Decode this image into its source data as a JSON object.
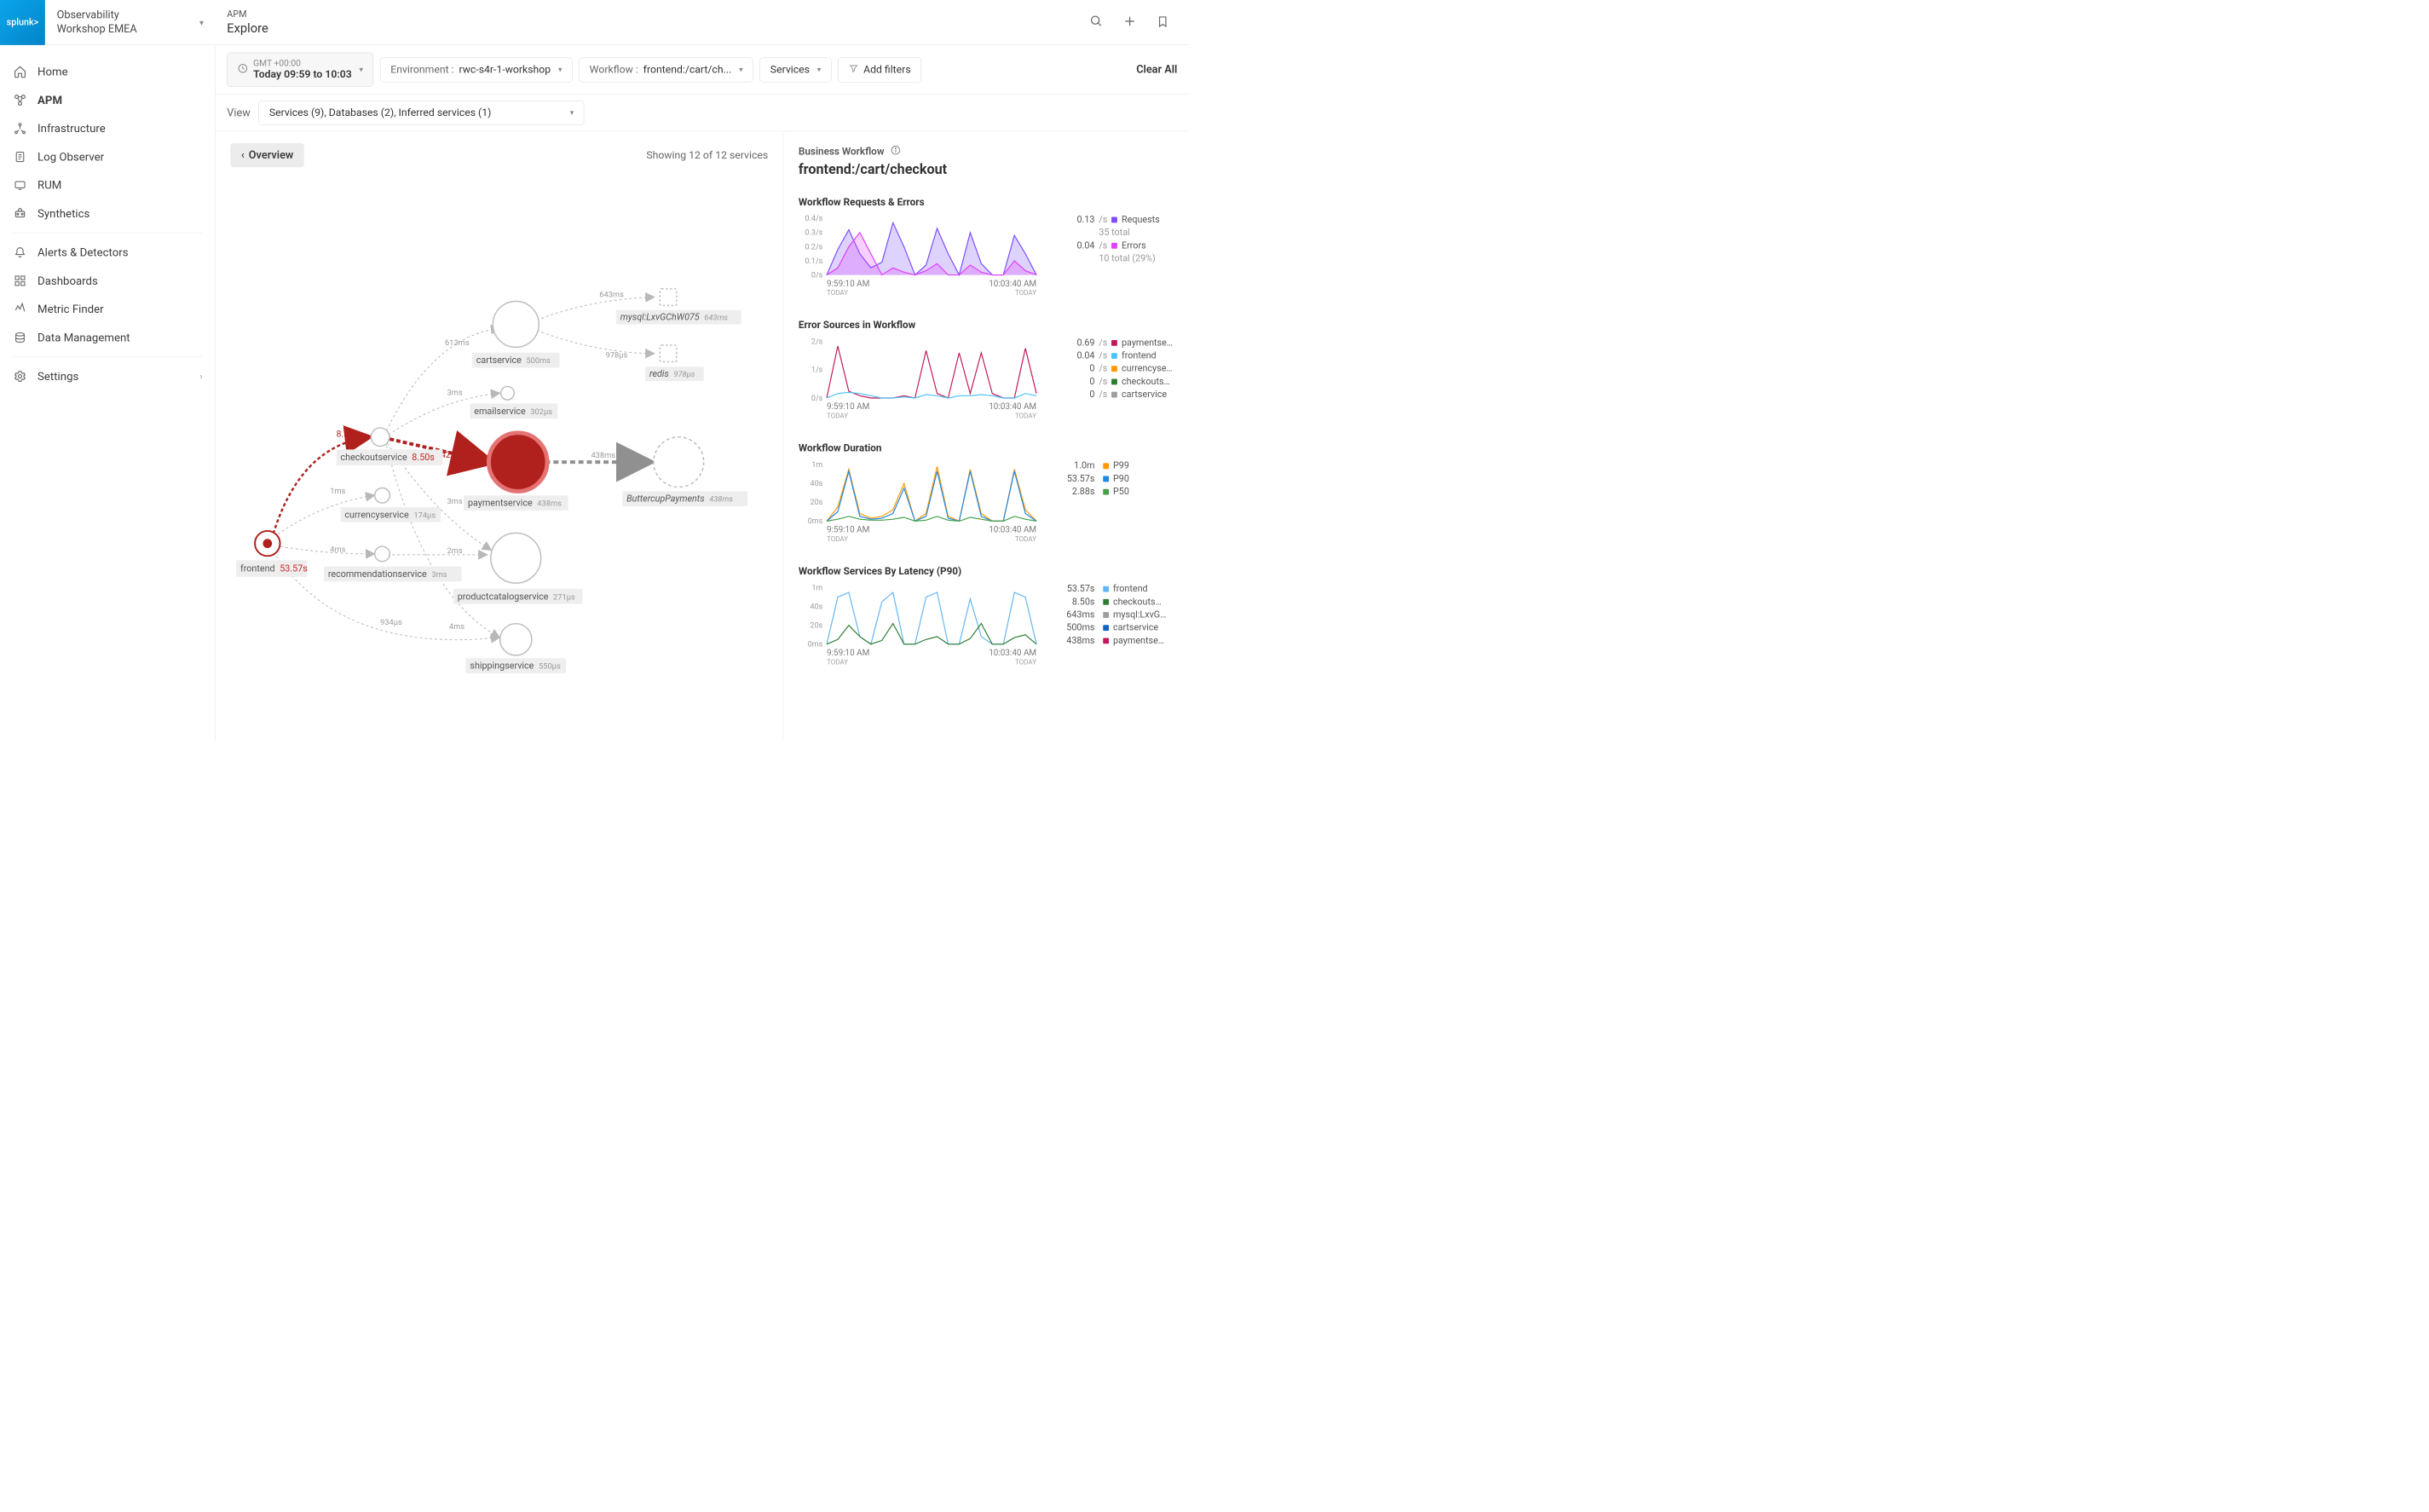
{
  "header": {
    "logo": "splunk>",
    "workspace": "Observability\nWorkshop EMEA",
    "breadcrumb_top": "APM",
    "breadcrumb_bottom": "Explore"
  },
  "sidebar": {
    "items": [
      {
        "label": "Home",
        "icon": "home"
      },
      {
        "label": "APM",
        "icon": "apm",
        "active": true
      },
      {
        "label": "Infrastructure",
        "icon": "infra"
      },
      {
        "label": "Log Observer",
        "icon": "log"
      },
      {
        "label": "RUM",
        "icon": "rum"
      },
      {
        "label": "Synthetics",
        "icon": "synth"
      }
    ],
    "items2": [
      {
        "label": "Alerts & Detectors",
        "icon": "alert"
      },
      {
        "label": "Dashboards",
        "icon": "dash"
      },
      {
        "label": "Metric Finder",
        "icon": "metric"
      },
      {
        "label": "Data Management",
        "icon": "data"
      }
    ],
    "settings": "Settings"
  },
  "filters": {
    "time_tz": "GMT +00:00",
    "time_range": "Today 09:59 to 10:03",
    "env_label": "Environment :",
    "env_value": "rwc-s4r-1-workshop",
    "wf_label": "Workflow :",
    "wf_value": "frontend:/cart/ch...",
    "services": "Services",
    "add_filters": "Add filters",
    "clear": "Clear All"
  },
  "viewbar": {
    "view": "View",
    "selected": "Services (9), Databases (2), Inferred services (1)"
  },
  "map": {
    "overview": "Overview",
    "showing": "Showing 12 of 12 services",
    "nodes": {
      "frontend": {
        "name": "frontend",
        "lat": "53.57s",
        "err": true
      },
      "checkout": {
        "name": "checkoutservice",
        "lat": "8.50s",
        "err": true
      },
      "currency": {
        "name": "currencyservice",
        "lat": "174µs"
      },
      "recommendation": {
        "name": "recommendationservice",
        "lat": "3ms"
      },
      "payment": {
        "name": "paymentservice",
        "lat": "438ms",
        "err": true
      },
      "email": {
        "name": "emailservice",
        "lat": "302µs"
      },
      "productcatalog": {
        "name": "productcatalogservice",
        "lat": "271µs"
      },
      "shipping": {
        "name": "shippingservice",
        "lat": "550µs"
      },
      "cart": {
        "name": "cartservice",
        "lat": "500ms"
      },
      "buttercup": {
        "name": "ButtercupPayments",
        "lat": "438ms"
      },
      "mysql": {
        "name": "mysql:LxvGChW075",
        "lat": "643ms"
      },
      "redis": {
        "name": "redis",
        "lat": "978µs"
      }
    },
    "edges": {
      "f_checkout": "8.50s",
      "f_currency": "1ms",
      "f_recommendation": "4ms",
      "f_shipping": "934µs",
      "co_cart": "613ms",
      "co_email": "3ms",
      "co_payment": "425ms",
      "co_catalog": "3ms",
      "co_ship": "4ms",
      "rec_catalog": "2ms",
      "pay_butter": "438ms",
      "cart_mysql": "643ms",
      "cart_redis": "978µs"
    }
  },
  "right": {
    "bw_label": "Business Workflow",
    "bw_title": "frontend:/cart/checkout"
  },
  "charts": [
    {
      "title": "Workflow Requests & Errors",
      "yticks": [
        "0.4/s",
        "0.3/s",
        "0.2/s",
        "0.1/s",
        "0/s"
      ],
      "legend": [
        {
          "v": "0.13",
          "u": "/s",
          "c": "#7c4dff",
          "n": "Requests"
        },
        {
          "sub": "35  total"
        },
        {
          "v": "0.04",
          "u": "/s",
          "c": "#e040fb",
          "n": "Errors"
        },
        {
          "sub": "10  total (29%)"
        }
      ]
    },
    {
      "title": "Error Sources in Workflow",
      "yticks": [
        "2/s",
        "1/s",
        "0/s"
      ],
      "legend": [
        {
          "v": "0.69",
          "u": "/s",
          "c": "#c2185b",
          "n": "paymentse…"
        },
        {
          "v": "0.04",
          "u": "/s",
          "c": "#4fc3f7",
          "n": "frontend"
        },
        {
          "v": "0",
          "u": "/s",
          "c": "#ff9800",
          "n": "currencyse…"
        },
        {
          "v": "0",
          "u": "/s",
          "c": "#2e7d32",
          "n": "checkouts…"
        },
        {
          "v": "0",
          "u": "/s",
          "c": "#9e9e9e",
          "n": "cartservice"
        }
      ]
    },
    {
      "title": "Workflow Duration",
      "yticks": [
        "1m",
        "40s",
        "20s",
        "0ms"
      ],
      "legend": [
        {
          "v": "1.0m",
          "u": "",
          "c": "#ff9800",
          "n": "P99"
        },
        {
          "v": "53.57s",
          "u": "",
          "c": "#1e88e5",
          "n": "P90"
        },
        {
          "v": "2.88s",
          "u": "",
          "c": "#43a047",
          "n": "P50"
        }
      ]
    },
    {
      "title": "Workflow Services By Latency (P90)",
      "yticks": [
        "1m",
        "40s",
        "20s",
        "0ms"
      ],
      "legend": [
        {
          "v": "53.57s",
          "u": "",
          "c": "#64b5f6",
          "n": "frontend"
        },
        {
          "v": "8.50s",
          "u": "",
          "c": "#2e7d32",
          "n": "checkouts…"
        },
        {
          "v": "643ms",
          "u": "",
          "c": "#9e9e9e",
          "n": "mysql:LxvG…"
        },
        {
          "v": "500ms",
          "u": "",
          "c": "#1565c0",
          "n": "cartservice"
        },
        {
          "v": "438ms",
          "u": "",
          "c": "#c2185b",
          "n": "paymentse…"
        }
      ]
    }
  ],
  "time_axis": {
    "start": "9:59:10 AM",
    "end": "10:03:40 AM",
    "today": "TODAY"
  },
  "chart_data": [
    {
      "type": "area",
      "title": "Workflow Requests & Errors",
      "x": [
        0,
        1,
        2,
        3,
        4,
        5,
        6,
        7,
        8,
        9,
        10,
        11,
        12,
        13,
        14,
        15,
        16,
        17,
        18,
        19
      ],
      "series": [
        {
          "name": "Requests",
          "values": [
            0,
            0.18,
            0.32,
            0.15,
            0.05,
            0.09,
            0.37,
            0.2,
            0,
            0.07,
            0.33,
            0.15,
            0,
            0.3,
            0.08,
            0,
            0,
            0.28,
            0.15,
            0
          ]
        },
        {
          "name": "Errors",
          "values": [
            0,
            0.05,
            0.2,
            0.3,
            0.15,
            0,
            0.05,
            0.02,
            0,
            0.03,
            0.08,
            0,
            0,
            0.07,
            0.02,
            0,
            0,
            0.1,
            0.03,
            0
          ]
        }
      ],
      "ylim": [
        0,
        0.4
      ]
    },
    {
      "type": "line",
      "title": "Error Sources in Workflow",
      "x": [
        0,
        1,
        2,
        3,
        4,
        5,
        6,
        7,
        8,
        9,
        10,
        11,
        12,
        13,
        14,
        15,
        16,
        17,
        18,
        19
      ],
      "series": [
        {
          "name": "paymentservice",
          "values": [
            0,
            2.3,
            0.3,
            0.1,
            0,
            0,
            0,
            0.1,
            0,
            2.1,
            0.2,
            0,
            2.0,
            0.2,
            2.0,
            0.2,
            0,
            0,
            2.2,
            0.2
          ]
        },
        {
          "name": "frontend",
          "values": [
            0,
            0.2,
            0.25,
            0.2,
            0.1,
            0,
            0,
            0.05,
            0,
            0.15,
            0.1,
            0,
            0.1,
            0.1,
            0.15,
            0.1,
            0,
            0,
            0.2,
            0.1
          ]
        }
      ],
      "ylim": [
        0,
        2.5
      ]
    },
    {
      "type": "line",
      "title": "Workflow Duration",
      "x": [
        0,
        1,
        2,
        3,
        4,
        5,
        6,
        7,
        8,
        9,
        10,
        11,
        12,
        13,
        14,
        15,
        16,
        17,
        18,
        19
      ],
      "series": [
        {
          "name": "P99",
          "values": [
            0,
            15,
            55,
            8,
            3,
            5,
            12,
            40,
            0,
            8,
            58,
            5,
            0,
            55,
            8,
            0,
            0,
            55,
            12,
            0
          ]
        },
        {
          "name": "P90",
          "values": [
            0,
            10,
            53,
            5,
            2,
            3,
            8,
            35,
            0,
            5,
            53,
            3,
            0,
            53,
            5,
            0,
            0,
            53,
            8,
            0
          ]
        },
        {
          "name": "P50",
          "values": [
            0,
            2,
            5,
            2,
            1,
            1,
            2,
            4,
            0,
            1,
            5,
            1,
            0,
            4,
            2,
            0,
            0,
            5,
            2,
            0
          ]
        }
      ],
      "ylim": [
        0,
        60
      ]
    },
    {
      "type": "line",
      "title": "Workflow Services By Latency (P90)",
      "x": [
        0,
        1,
        2,
        3,
        4,
        5,
        6,
        7,
        8,
        9,
        10,
        11,
        12,
        13,
        14,
        15,
        16,
        17,
        18,
        19
      ],
      "series": [
        {
          "name": "frontend",
          "values": [
            0,
            50,
            55,
            8,
            0,
            45,
            55,
            0,
            0,
            50,
            55,
            0,
            0,
            48,
            8,
            0,
            0,
            55,
            50,
            0
          ]
        },
        {
          "name": "checkoutservice",
          "values": [
            0,
            5,
            20,
            8,
            0,
            4,
            22,
            0,
            0,
            5,
            8,
            0,
            0,
            6,
            22,
            0,
            0,
            7,
            10,
            0
          ]
        }
      ],
      "ylim": [
        0,
        60
      ]
    }
  ]
}
